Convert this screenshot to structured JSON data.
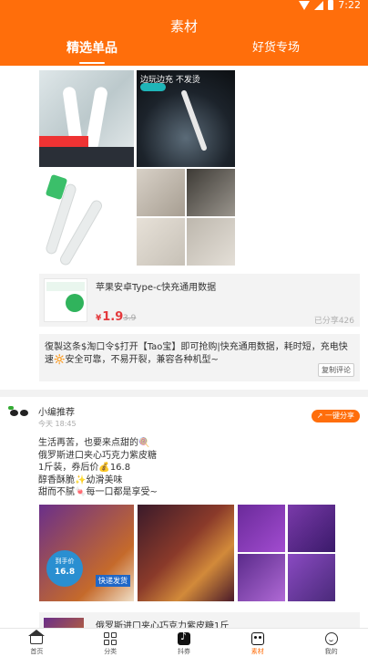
{
  "status_bar": {
    "time": "7:22"
  },
  "header": {
    "title": "素材"
  },
  "tabs": [
    {
      "label": "精选单品",
      "active": true
    },
    {
      "label": "好货专场",
      "active": false
    }
  ],
  "item1": {
    "image_caption": "边玩边充 不发烫",
    "product": {
      "name": "苹果安卓Type-c快充通用数据",
      "price": "1.9",
      "currency": "¥",
      "original_price": "3.9",
      "shared": "已分享426"
    },
    "copy_text": "復製这条$淘口令$打开【Tao宝】即可抢购|快充通用数据，耗时短，充电快速🔆安全可靠，不易开裂，兼容各种机型~",
    "copy_button": "复制评论"
  },
  "item2": {
    "user": "小编推荐",
    "time": "今天 18:45",
    "share_button": "一键分享",
    "post_lines": [
      "生活再苦，也要来点甜的🍭",
      "俄罗斯进口夹心巧克力紫皮糖",
      "1斤装，券后价💰16.8",
      "醇香酥脆✨幼滑美味",
      "甜而不腻🍬每一口都是享受~"
    ],
    "badge_price": "16.8",
    "badge_text": "到手价",
    "fast_label": "快递发货",
    "product_name": "俄罗斯进口夹心巧克力紫皮糖1斤"
  },
  "tabbar": [
    {
      "label": "首页",
      "icon": "home-icon",
      "active": false
    },
    {
      "label": "分类",
      "icon": "category-icon",
      "active": false
    },
    {
      "label": "抖券",
      "icon": "douyin-icon",
      "active": false
    },
    {
      "label": "素材",
      "icon": "material-icon",
      "active": true
    },
    {
      "label": "我的",
      "icon": "profile-icon",
      "active": false
    }
  ],
  "colors": {
    "brand": "#ff6e0b",
    "price": "#e4393c"
  }
}
